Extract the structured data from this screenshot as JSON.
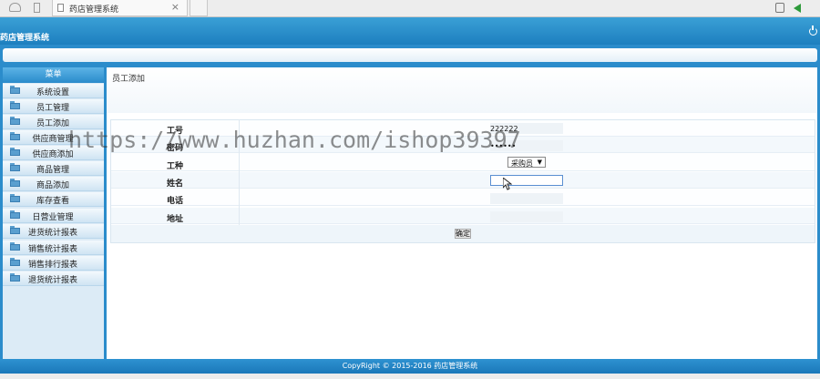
{
  "browser": {
    "tab_title": "药店管理系统",
    "tab_close": "×"
  },
  "header": {
    "app_title": "药店管理系统"
  },
  "sidebar": {
    "title": "菜单",
    "items": [
      {
        "label": "系统设置"
      },
      {
        "label": "员工管理"
      },
      {
        "label": "员工添加"
      },
      {
        "label": "供应商管理"
      },
      {
        "label": "供应商添加"
      },
      {
        "label": "商品管理"
      },
      {
        "label": "商品添加"
      },
      {
        "label": "库存查看"
      },
      {
        "label": "日营业管理"
      },
      {
        "label": "进货统计报表"
      },
      {
        "label": "销售统计报表"
      },
      {
        "label": "销售排行报表"
      },
      {
        "label": "退货统计报表"
      }
    ]
  },
  "content": {
    "breadcrumb": "员工添加",
    "form": {
      "id_label": "工号",
      "id_value": "222222",
      "password_label": "密码",
      "password_value": "••••••",
      "type_label": "工种",
      "type_value": "采购员",
      "name_label": "姓名",
      "name_value": "",
      "phone_label": "电话",
      "phone_value": "",
      "address_label": "地址",
      "address_value": "",
      "submit_label": "确定"
    }
  },
  "footer": {
    "copyright": "CopyRight © 2015-2016 药店管理系统"
  },
  "watermark": "https://www.huzhan.com/ishop39397"
}
